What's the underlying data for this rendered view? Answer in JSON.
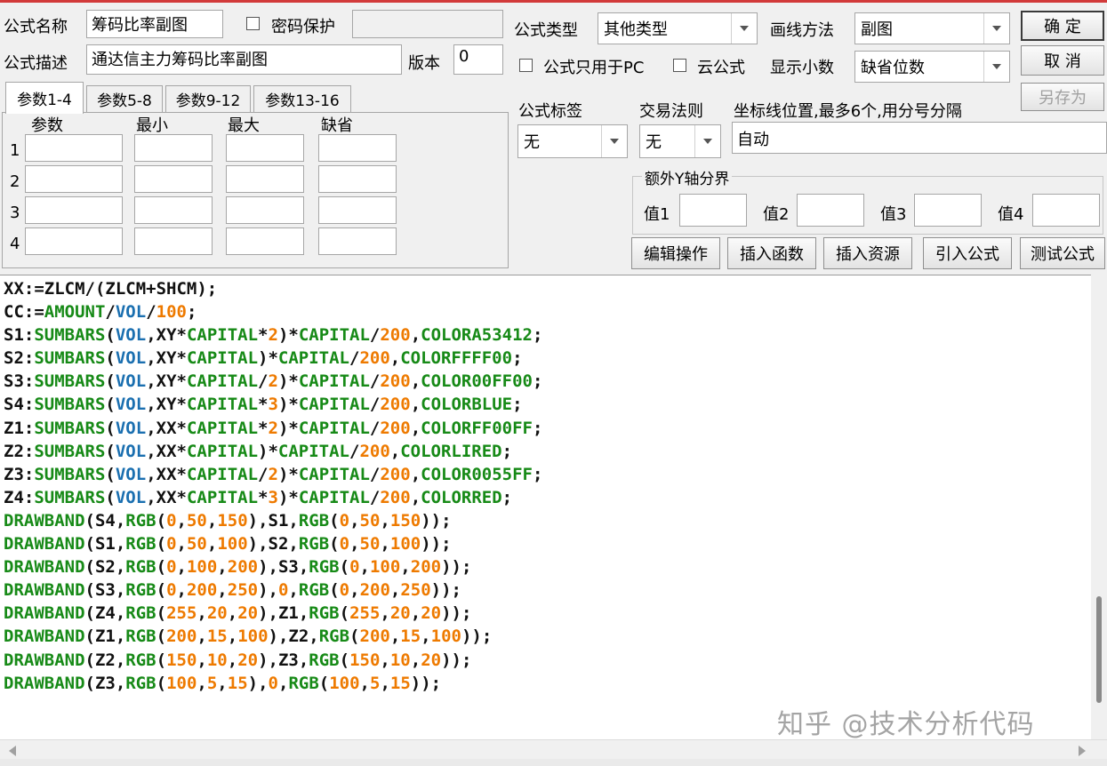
{
  "form": {
    "name_label": "公式名称",
    "name_value": "筹码比率副图",
    "password_label": "密码保护",
    "password_checked": false,
    "desc_label": "公式描述",
    "desc_value": "通达信主力筹码比率副图",
    "version_label": "版本",
    "version_value": "0",
    "type_label": "公式类型",
    "type_value": "其他类型",
    "draw_label": "画线方法",
    "draw_value": "副图",
    "pc_only_label": "公式只用于PC",
    "cloud_label": "云公式",
    "decimals_label": "显示小数",
    "decimals_value": "缺省位数",
    "tag_label": "公式标签",
    "tag_value": "无",
    "rule_label": "交易法则",
    "rule_value": "无",
    "coord_label": "坐标线位置,最多6个,用分号分隔",
    "coord_value": "自动",
    "yaxis_title": "额外Y轴分界",
    "y1_label": "值1",
    "y2_label": "值2",
    "y3_label": "值3",
    "y4_label": "值4"
  },
  "buttons": {
    "ok": "确  定",
    "cancel": "取  消",
    "save_as": "另存为",
    "edit_ops": "编辑操作",
    "insert_func": "插入函数",
    "insert_res": "插入资源",
    "import_formula": "引入公式",
    "test_formula": "测试公式"
  },
  "tabs": [
    "参数1-4",
    "参数5-8",
    "参数9-12",
    "参数13-16"
  ],
  "params": {
    "headers": [
      "参数",
      "最小",
      "最大",
      "缺省"
    ],
    "rows": [
      "1",
      "2",
      "3",
      "4"
    ]
  },
  "code_lines": [
    "XX:=ZLCM/(ZLCM+SHCM);",
    "CC:=AMOUNT/VOL/100;",
    "S1:SUMBARS(VOL,XY*CAPITAL*2)*CAPITAL/200,COLORA53412;",
    "S2:SUMBARS(VOL,XY*CAPITAL)*CAPITAL/200,COLORFFFF00;",
    "S3:SUMBARS(VOL,XY*CAPITAL/2)*CAPITAL/200,COLOR00FF00;",
    "S4:SUMBARS(VOL,XY*CAPITAL*3)*CAPITAL/200,COLORBLUE;",
    "Z1:SUMBARS(VOL,XX*CAPITAL*2)*CAPITAL/200,COLORFF00FF;",
    "Z2:SUMBARS(VOL,XX*CAPITAL)*CAPITAL/200,COLORLIRED;",
    "Z3:SUMBARS(VOL,XX*CAPITAL/2)*CAPITAL/200,COLOR0055FF;",
    "Z4:SUMBARS(VOL,XX*CAPITAL*3)*CAPITAL/200,COLORRED;",
    "DRAWBAND(S4,RGB(0,50,150),S1,RGB(0,50,150));",
    "DRAWBAND(S1,RGB(0,50,100),S2,RGB(0,50,100));",
    "DRAWBAND(S2,RGB(0,100,200),S3,RGB(0,100,200));",
    "DRAWBAND(S3,RGB(0,200,250),0,RGB(0,200,250));",
    "DRAWBAND(Z4,RGB(255,20,20),Z1,RGB(255,20,20));",
    "DRAWBAND(Z1,RGB(200,15,100),Z2,RGB(200,15,100));",
    "DRAWBAND(Z2,RGB(150,10,20),Z3,RGB(150,10,20));",
    "DRAWBAND(Z3,RGB(100,5,15),0,RGB(100,5,15));"
  ],
  "syntax_colors": {
    "function": "#178a17",
    "variable": "#1a6fb0",
    "number": "#ee7a00",
    "default": "#111111"
  },
  "icons": {
    "dropdown": "chevron-down-icon",
    "scroll_left": "arrow-left-icon",
    "scroll_right": "arrow-right-icon"
  },
  "watermark": "知乎 @技术分析代码"
}
